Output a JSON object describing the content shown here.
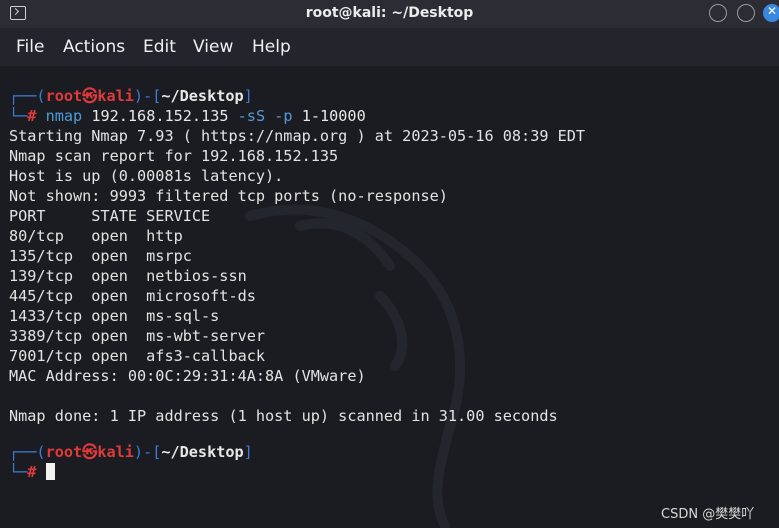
{
  "window": {
    "title": "root@kali: ~/Desktop"
  },
  "menu": [
    "File",
    "Actions",
    "Edit",
    "View",
    "Help"
  ],
  "prompt": {
    "open": "┌──(",
    "user": "root",
    "at": "㉿",
    "host": "kali",
    "mid": ")-[",
    "path": "~/Desktop",
    "close": "]",
    "hash_prefix": "└─",
    "hash": "#"
  },
  "command": {
    "name": "nmap",
    "target": "192.168.152.135",
    "flag1": "-sS",
    "flag2": "-p",
    "ports": "1-10000"
  },
  "output": [
    "Starting Nmap 7.93 ( https://nmap.org ) at 2023-05-16 08:39 EDT",
    "Nmap scan report for 192.168.152.135",
    "Host is up (0.00081s latency).",
    "Not shown: 9993 filtered tcp ports (no-response)",
    "PORT     STATE SERVICE",
    "80/tcp   open  http",
    "135/tcp  open  msrpc",
    "139/tcp  open  netbios-ssn",
    "445/tcp  open  microsoft-ds",
    "1433/tcp open  ms-sql-s",
    "3389/tcp open  ms-wbt-server",
    "7001/tcp open  afs3-callback",
    "MAC Address: 00:0C:29:31:4A:8A (VMware)",
    "",
    "Nmap done: 1 IP address (1 host up) scanned in 31.00 seconds"
  ],
  "watermark": "CSDN @樊樊吖",
  "colors": {
    "prompt_blue": "#3d7cd6",
    "prompt_red": "#e03a3a",
    "close_button": "#3a88e0"
  }
}
